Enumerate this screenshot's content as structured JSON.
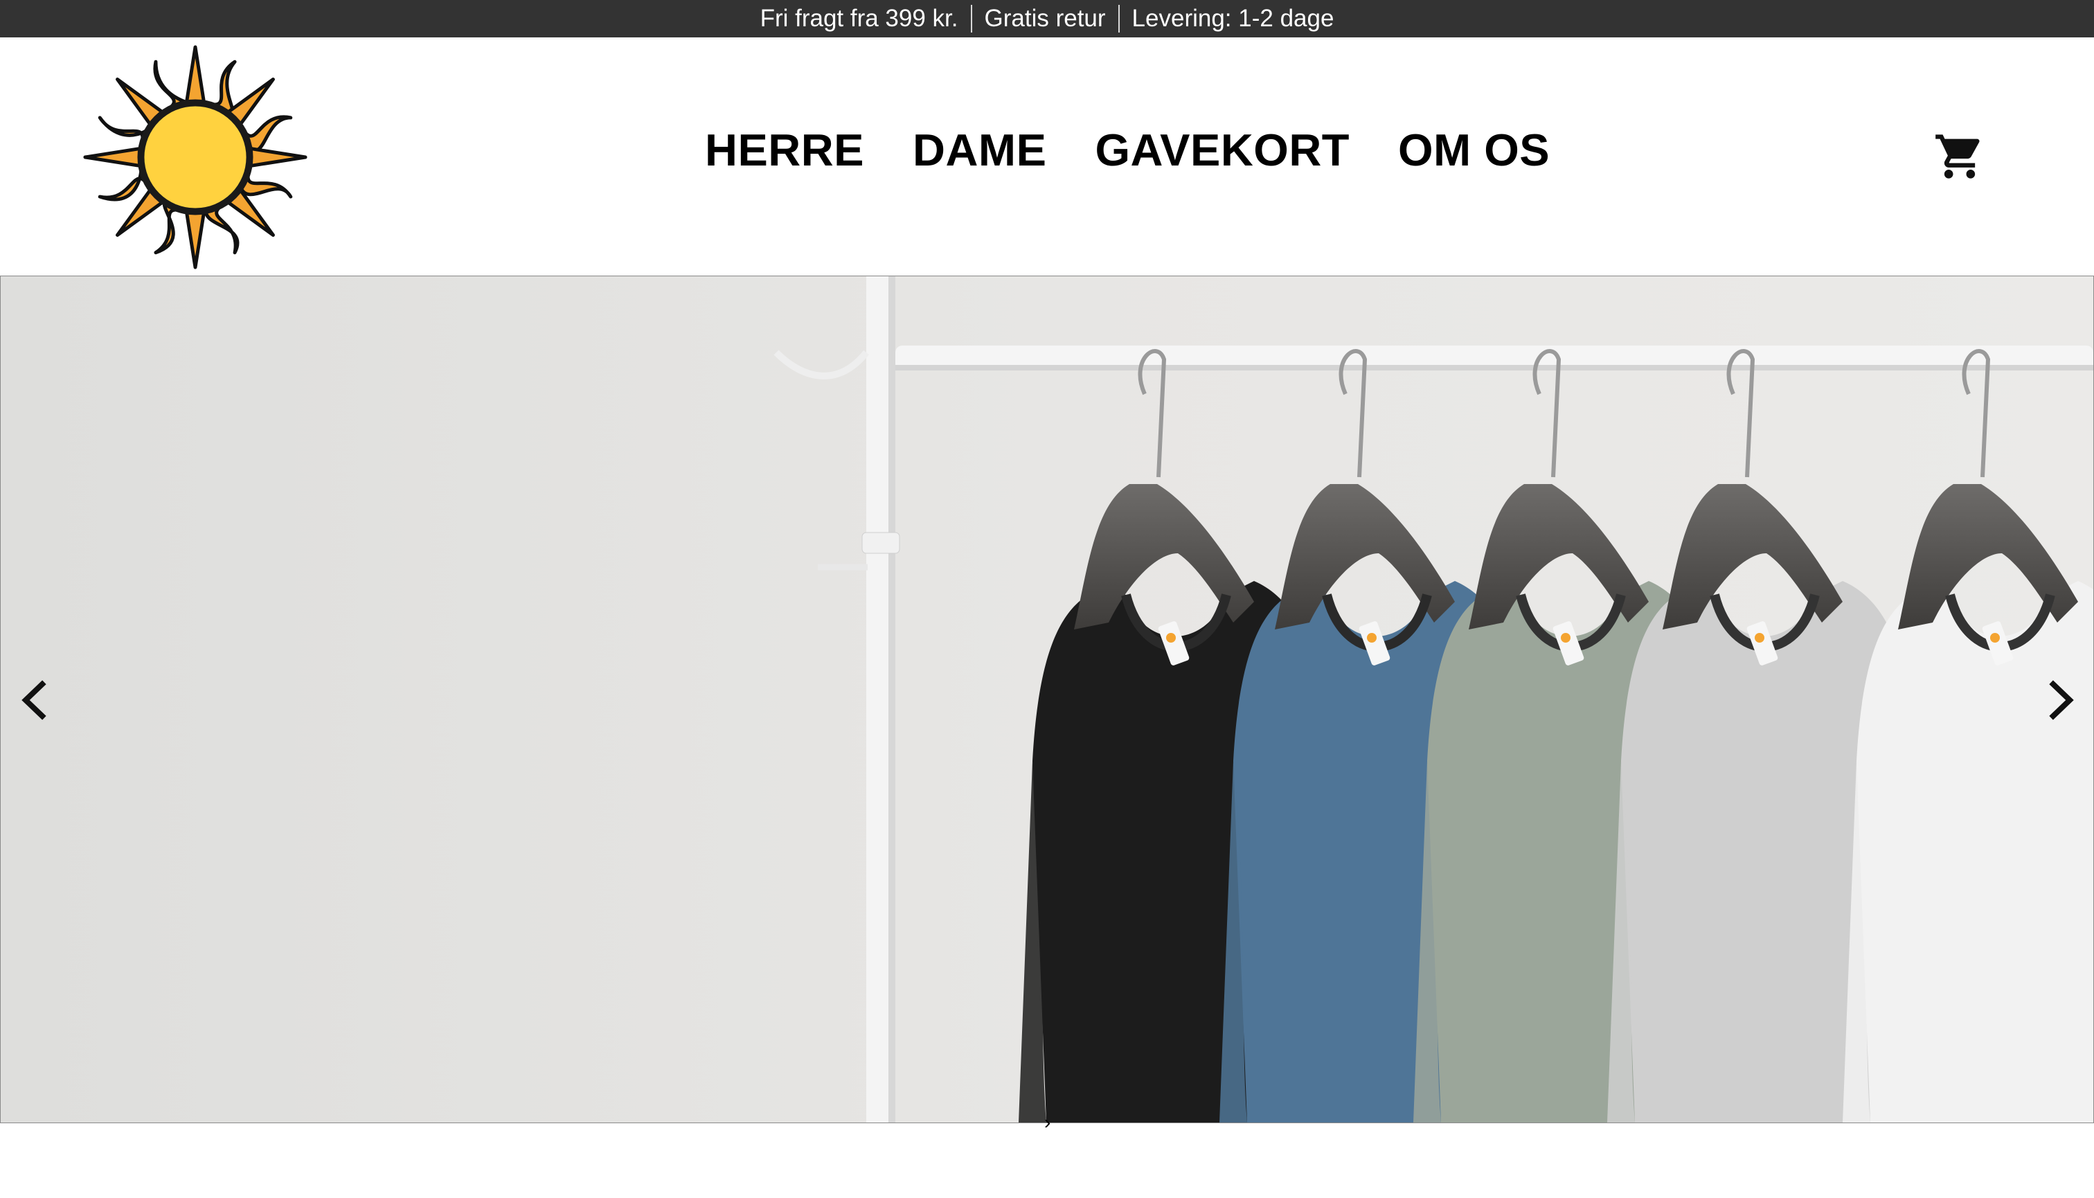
{
  "announcement": {
    "items": [
      "Fri fragt fra 399 kr.",
      "Gratis retur",
      "Levering: 1-2 dage"
    ]
  },
  "header": {
    "logo_icon": "sun-logo-icon",
    "nav": [
      "HERRE",
      "DAME",
      "GAVEKORT",
      "OM OS"
    ],
    "cart_icon": "shopping-cart-icon"
  },
  "hero": {
    "image": "t-shirts-on-clothes-rack",
    "shirt_colors": [
      "#1c1c1c",
      "#4f7597",
      "#9ba69a",
      "#cfcfcf",
      "#f2f2f2"
    ],
    "prev_icon": "chevron-left-icon",
    "next_icon": "chevron-right-icon",
    "small_chevron": "›"
  },
  "colors": {
    "announcement_bg": "#333333",
    "sun_orange": "#f4a431",
    "sun_yellow": "#ffd23f"
  }
}
